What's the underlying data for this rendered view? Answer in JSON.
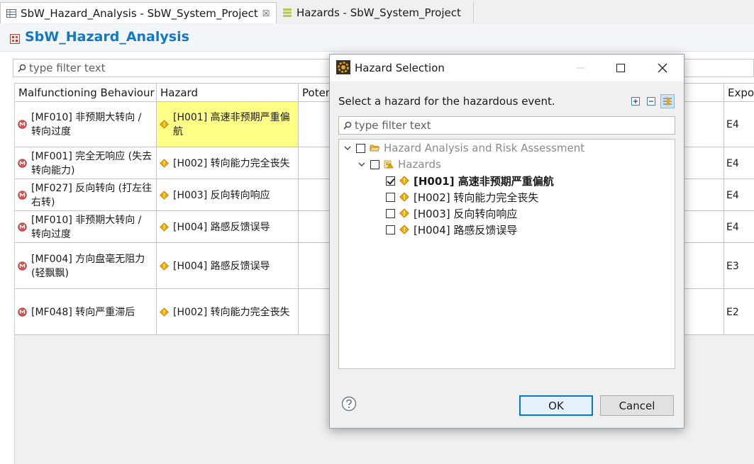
{
  "tabs": [
    {
      "label": "SbW_Hazard_Analysis - SbW_System_Project",
      "active": true,
      "close": "☒"
    },
    {
      "label": "Hazards - SbW_System_Project",
      "active": false
    }
  ],
  "editor": {
    "title": "SbW_Hazard_Analysis"
  },
  "filter": {
    "placeholder": "type filter text"
  },
  "table": {
    "columns": [
      "Malfunctioning Behaviour",
      "Hazard",
      "Poten",
      "Expos"
    ],
    "rows": [
      {
        "malfunction": "[MF010] 非预期大转向 / 转向过度",
        "hazard": "[H001] 高速非预期严重偏航",
        "exposure": "E4",
        "selected": true
      },
      {
        "malfunction": "[MF001] 完全无响应 (失去转向能力)",
        "hazard": "[H002] 转向能力完全丧失",
        "exposure": "E4"
      },
      {
        "malfunction": "[MF027] 反向转向 (打左往右转)",
        "hazard": "[H003] 反向转向响应",
        "exposure": "E4"
      },
      {
        "malfunction": "[MF010] 非预期大转向 / 转向过度",
        "hazard": "[H004] 路感反馈误导",
        "exposure": "E4"
      },
      {
        "malfunction": "[MF004] 方向盘毫无阻力 (轻飘飘)",
        "hazard": "[H004] 路感反馈误导",
        "exposure": "E3"
      },
      {
        "malfunction": "[MF048] 转向严重滞后",
        "hazard": "[H002] 转向能力完全丧失",
        "exposure": "E2"
      }
    ]
  },
  "dialog": {
    "title": "Hazard Selection",
    "message": "Select a hazard for the hazardous event.",
    "filter_placeholder": "type filter text",
    "tree": {
      "root": "Hazard Analysis and Risk Assessment",
      "folder": "Hazards",
      "items": [
        {
          "label": "[H001] 高速非预期严重偏航",
          "checked": true
        },
        {
          "label": "[H002] 转向能力完全丧失",
          "checked": false
        },
        {
          "label": "[H003] 反向转向响应",
          "checked": false
        },
        {
          "label": "[H004] 路感反馈误导",
          "checked": false
        }
      ]
    },
    "ok_label": "OK",
    "cancel_label": "Cancel"
  },
  "colors": {
    "accent": "#0f78c8",
    "highlight": "#ffff88",
    "warning": "#f0a800",
    "malfunction": "#d9534f"
  }
}
